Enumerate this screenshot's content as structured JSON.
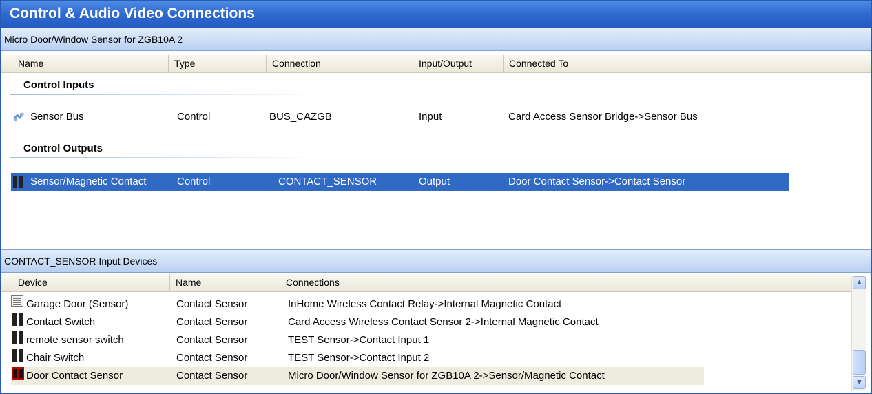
{
  "window": {
    "title": "Control & Audio Video Connections"
  },
  "device_panel": {
    "title": "Micro Door/Window Sensor for ZGB10A 2",
    "columns": [
      "Name",
      "Type",
      "Connection",
      "Input/Output",
      "Connected To"
    ],
    "sections": [
      {
        "label": "Control Inputs",
        "rows": [
          {
            "icon": "sensor-bus-icon",
            "name": "Sensor Bus",
            "type": "Control",
            "connection": "BUS_CAZGB",
            "io": "Input",
            "connected_to": "Card Access Sensor Bridge->Sensor Bus"
          }
        ]
      },
      {
        "label": "Control Outputs",
        "rows": [
          {
            "icon": "contact-icon",
            "name": "Sensor/Magnetic Contact",
            "type": "Control",
            "connection": "CONTACT_SENSOR",
            "io": "Output",
            "connected_to": "Door Contact Sensor->Contact Sensor",
            "selected": true
          }
        ]
      }
    ]
  },
  "input_devices_panel": {
    "title": "CONTACT_SENSOR Input Devices",
    "columns": [
      "Device",
      "Name",
      "Connections"
    ],
    "rows": [
      {
        "icon": "garage-door-icon",
        "device": "Garage Door (Sensor)",
        "name": "Contact Sensor",
        "connections": "InHome Wireless Contact Relay->Internal Magnetic Contact"
      },
      {
        "icon": "contact-switch-icon",
        "device": "Contact Switch",
        "name": "Contact Sensor",
        "connections": "Card Access Wireless Contact Sensor 2->Internal Magnetic Contact"
      },
      {
        "icon": "contact-switch-icon",
        "device": "remote sensor switch",
        "name": "Contact Sensor",
        "connections": "TEST Sensor->Contact Input 1"
      },
      {
        "icon": "contact-switch-icon",
        "device": "Chair Switch",
        "name": "Contact Sensor",
        "connections": "TEST Sensor->Contact Input 2"
      },
      {
        "icon": "door-contact-icon",
        "device": "Door Contact Sensor",
        "name": "Contact Sensor",
        "connections": "Micro Door/Window Sensor for ZGB10A 2->Sensor/Magnetic Contact",
        "highlighted": true
      }
    ]
  },
  "colors": {
    "title_bar": "#2f6ad0",
    "selection": "#316ac5",
    "highlight_row": "#eeecde"
  }
}
